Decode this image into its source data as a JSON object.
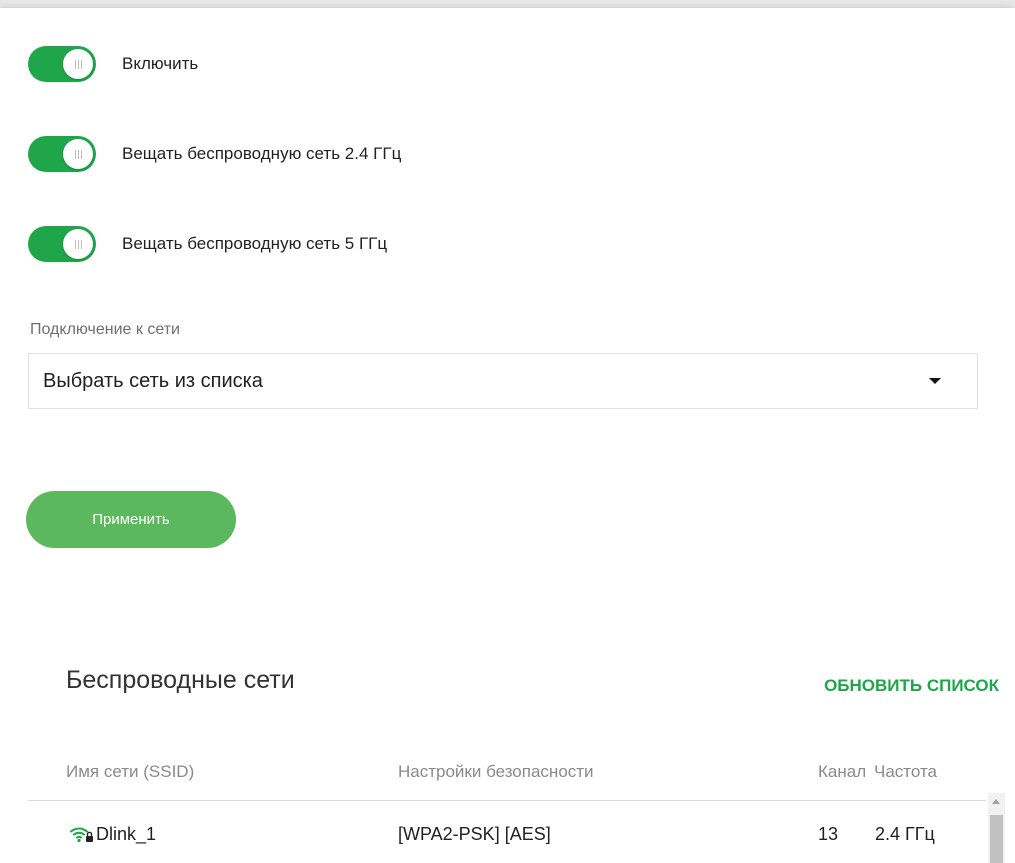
{
  "toggles": [
    {
      "label": "Включить",
      "on": true
    },
    {
      "label": "Вещать беспроводную сеть 2.4 ГГц",
      "on": true
    },
    {
      "label": "Вещать беспроводную сеть 5 ГГц",
      "on": true
    }
  ],
  "network_connection": {
    "label": "Подключение к сети",
    "selected": "Выбрать сеть из списка"
  },
  "apply_label": "Применить",
  "wireless_networks": {
    "title": "Беспроводные сети",
    "refresh_label": "ОБНОВИТЬ СПИСОК",
    "columns": {
      "ssid": "Имя сети (SSID)",
      "security": "Настройки безопасности",
      "channel": "Канал",
      "frequency": "Частота"
    },
    "rows": [
      {
        "icon": "wifi-lock-icon",
        "ssid": "Dlink_1",
        "security": "[WPA2-PSK] [AES]",
        "channel": "13",
        "frequency": "2.4 ГГц"
      }
    ]
  },
  "colors": {
    "accent": "#1fa64a",
    "button": "#5cb85c"
  }
}
